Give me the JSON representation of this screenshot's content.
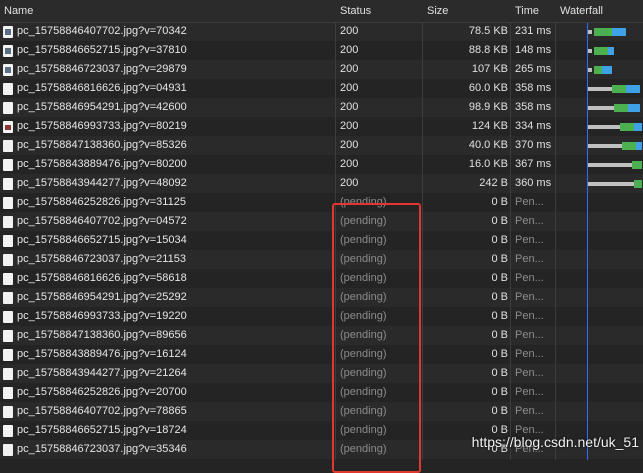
{
  "columns": {
    "name": "Name",
    "status": "Status",
    "size": "Size",
    "time": "Time",
    "waterfall": "Waterfall"
  },
  "rows": [
    {
      "name": "pc_15758846407702.jpg?v=70342",
      "status": "200",
      "size": "78.5 KB",
      "time": "231 ms",
      "icon": "image-file-icon"
    },
    {
      "name": "pc_15758846652715.jpg?v=37810",
      "status": "200",
      "size": "88.8 KB",
      "time": "148 ms",
      "icon": "image-file-icon"
    },
    {
      "name": "pc_15758846723037.jpg?v=29879",
      "status": "200",
      "size": "107 KB",
      "time": "265 ms",
      "icon": "image-file-icon"
    },
    {
      "name": "pc_15758846816626.jpg?v=04931",
      "status": "200",
      "size": "60.0 KB",
      "time": "358 ms",
      "icon": "file-icon"
    },
    {
      "name": "pc_15758846954291.jpg?v=42600",
      "status": "200",
      "size": "98.9 KB",
      "time": "358 ms",
      "icon": "file-icon"
    },
    {
      "name": "pc_15758846993733.jpg?v=80219",
      "status": "200",
      "size": "124 KB",
      "time": "334 ms",
      "icon": "image-file-icon"
    },
    {
      "name": "pc_15758847138360.jpg?v=85326",
      "status": "200",
      "size": "40.0 KB",
      "time": "370 ms",
      "icon": "file-icon"
    },
    {
      "name": "pc_15758843889476.jpg?v=80200",
      "status": "200",
      "size": "16.0 KB",
      "time": "367 ms",
      "icon": "file-icon"
    },
    {
      "name": "pc_15758843944277.jpg?v=48092",
      "status": "200",
      "size": "242 B",
      "time": "360 ms",
      "icon": "file-icon"
    },
    {
      "name": "pc_15758846252826.jpg?v=31125",
      "status": "(pending)",
      "size": "0 B",
      "time": "Pen...",
      "icon": "file-icon"
    },
    {
      "name": "pc_15758846407702.jpg?v=04572",
      "status": "(pending)",
      "size": "0 B",
      "time": "Pen...",
      "icon": "file-icon"
    },
    {
      "name": "pc_15758846652715.jpg?v=15034",
      "status": "(pending)",
      "size": "0 B",
      "time": "Pen...",
      "icon": "file-icon"
    },
    {
      "name": "pc_15758846723037.jpg?v=21153",
      "status": "(pending)",
      "size": "0 B",
      "time": "Pen...",
      "icon": "file-icon"
    },
    {
      "name": "pc_15758846816626.jpg?v=58618",
      "status": "(pending)",
      "size": "0 B",
      "time": "Pen...",
      "icon": "file-icon"
    },
    {
      "name": "pc_15758846954291.jpg?v=25292",
      "status": "(pending)",
      "size": "0 B",
      "time": "Pen...",
      "icon": "file-icon"
    },
    {
      "name": "pc_15758846993733.jpg?v=19220",
      "status": "(pending)",
      "size": "0 B",
      "time": "Pen...",
      "icon": "file-icon"
    },
    {
      "name": "pc_15758847138360.jpg?v=89656",
      "status": "(pending)",
      "size": "0 B",
      "time": "Pen...",
      "icon": "file-icon"
    },
    {
      "name": "pc_15758843889476.jpg?v=16124",
      "status": "(pending)",
      "size": "0 B",
      "time": "Pen...",
      "icon": "file-icon"
    },
    {
      "name": "pc_15758843944277.jpg?v=21264",
      "status": "(pending)",
      "size": "0 B",
      "time": "Pen...",
      "icon": "file-icon"
    },
    {
      "name": "pc_15758846252826.jpg?v=20700",
      "status": "(pending)",
      "size": "0 B",
      "time": "Pen...",
      "icon": "file-icon"
    },
    {
      "name": "pc_15758846407702.jpg?v=78865",
      "status": "(pending)",
      "size": "0 B",
      "time": "Pen...",
      "icon": "file-icon"
    },
    {
      "name": "pc_15758846652715.jpg?v=18724",
      "status": "(pending)",
      "size": "0 B",
      "time": "Pen...",
      "icon": "file-icon"
    },
    {
      "name": "pc_15758846723037.jpg?v=35346",
      "status": "(pending)",
      "size": "0 B",
      "time": "Pen...",
      "icon": "file-icon"
    }
  ],
  "watermark": "https://blog.csdn.net/uk_51",
  "colors": {
    "background": "#242424",
    "pending_text": "#8c8c8c",
    "highlight_box": "#e0382f",
    "waterfall_queue": "#c0c0c0",
    "waterfall_waiting": "#4caf50",
    "waterfall_download": "#3fa1e6",
    "dom_content_line": "#3b66ff"
  }
}
